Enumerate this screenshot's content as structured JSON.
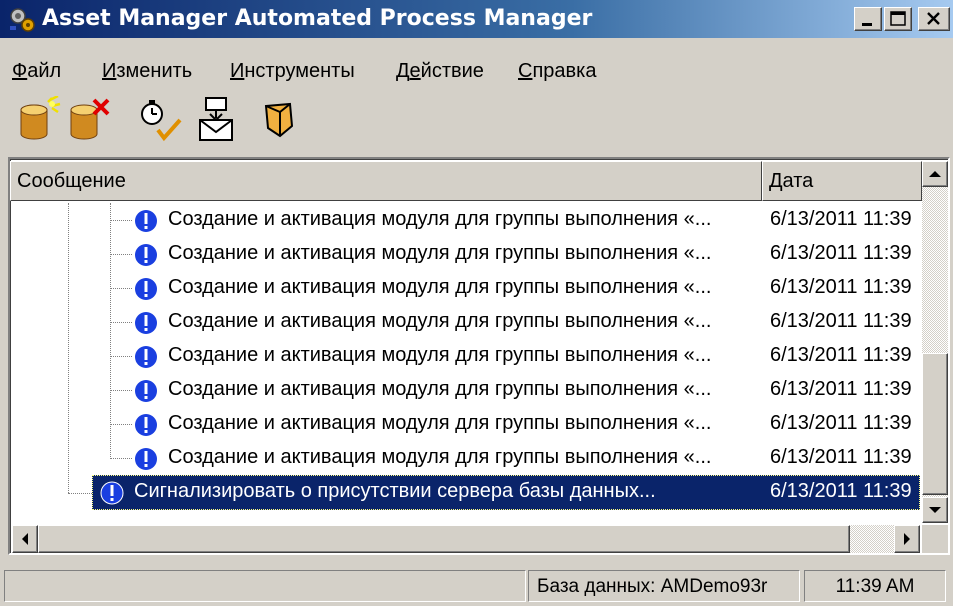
{
  "window": {
    "title": "Asset Manager Automated Process Manager",
    "app_icon": "gears-icon",
    "controls": [
      "minimize",
      "maximize",
      "close"
    ]
  },
  "menu": {
    "items": [
      {
        "label": "Файл",
        "accel": "Ф",
        "rest": "айл"
      },
      {
        "label": "Изменить",
        "accel": "И",
        "rest": "зменить"
      },
      {
        "label": "Инструменты",
        "accel": "И",
        "rest": "нструменты"
      },
      {
        "label": "Действие",
        "accel": "Д",
        "rest": "ействие",
        "accel_pos": 1
      },
      {
        "label": "Справка",
        "accel": "С",
        "rest": "правка"
      }
    ]
  },
  "toolbar": {
    "buttons": [
      {
        "name": "connect-database-icon"
      },
      {
        "name": "disconnect-database-icon"
      },
      {
        "name": "activate-timer-icon"
      },
      {
        "name": "send-mail-icon"
      },
      {
        "name": "database-module-icon"
      }
    ]
  },
  "list": {
    "columns": [
      "Сообщение",
      "Дата"
    ],
    "rows": [
      {
        "message": "Создание и активация модуля для группы выполнения «...",
        "date": "6/13/2011 11:39",
        "icon": "info-icon"
      },
      {
        "message": "Создание и активация модуля для группы выполнения «...",
        "date": "6/13/2011 11:39",
        "icon": "info-icon"
      },
      {
        "message": "Создание и активация модуля для группы выполнения «...",
        "date": "6/13/2011 11:39",
        "icon": "info-icon"
      },
      {
        "message": "Создание и активация модуля для группы выполнения «...",
        "date": "6/13/2011 11:39",
        "icon": "info-icon"
      },
      {
        "message": "Создание и активация модуля для группы выполнения «...",
        "date": "6/13/2011 11:39",
        "icon": "info-icon"
      },
      {
        "message": "Создание и активация модуля для группы выполнения «...",
        "date": "6/13/2011 11:39",
        "icon": "info-icon"
      },
      {
        "message": "Создание и активация модуля для группы выполнения «...",
        "date": "6/13/2011 11:39",
        "icon": "info-icon"
      },
      {
        "message": "Создание и активация модуля для группы выполнения «...",
        "date": "6/13/2011 11:39",
        "icon": "info-icon"
      },
      {
        "message": "Сигнализировать о присутствии сервера базы данных...",
        "date": "6/13/2011 11:39",
        "icon": "info-icon",
        "selected": true
      }
    ]
  },
  "status": {
    "database": "База данных: AMDemo93r",
    "time": "11:39 AM"
  },
  "colors": {
    "title_bar": "#0a246a",
    "selection": "#0a246a",
    "face": "#d4d0c8",
    "info_icon": "#1a3fe0"
  }
}
